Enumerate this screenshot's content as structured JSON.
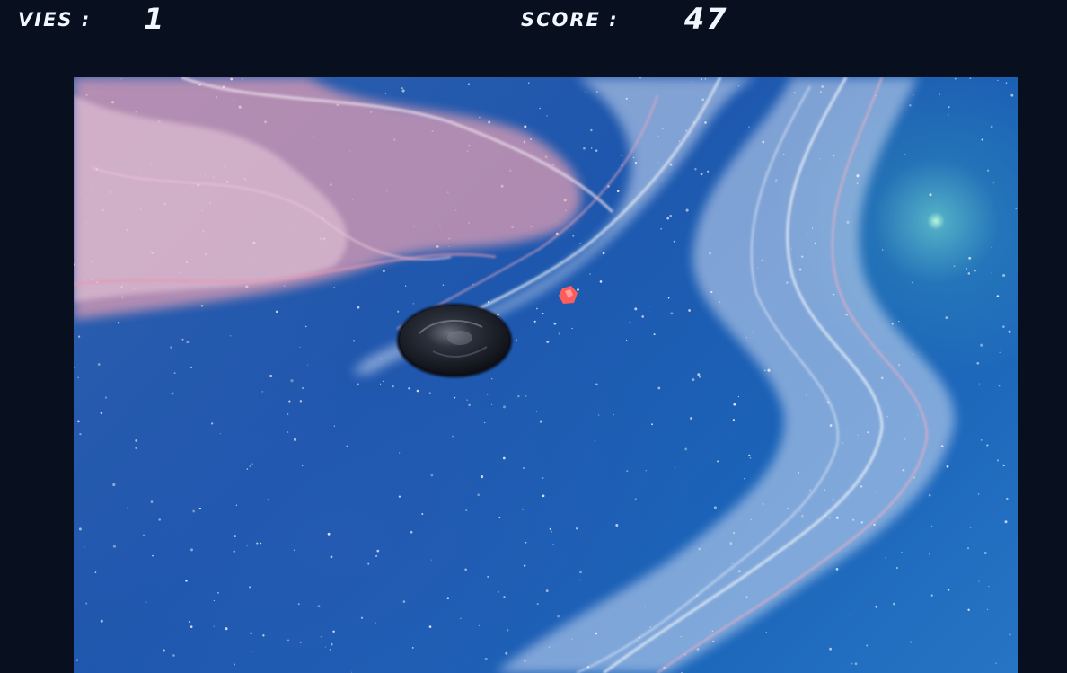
{
  "hud": {
    "lives_label": "VIES :",
    "lives_value": "1",
    "score_label": "SCORE :",
    "score_value": "47"
  },
  "scene": {
    "background": "space-nebula",
    "colors": {
      "space": "#1e57ad",
      "nebula_pink": "#ff8aa8",
      "nebula_white": "#eef3ff",
      "glow": "#c8ffe0",
      "projectile": "#ff5a5a",
      "asteroid": "#1c1f28"
    }
  }
}
